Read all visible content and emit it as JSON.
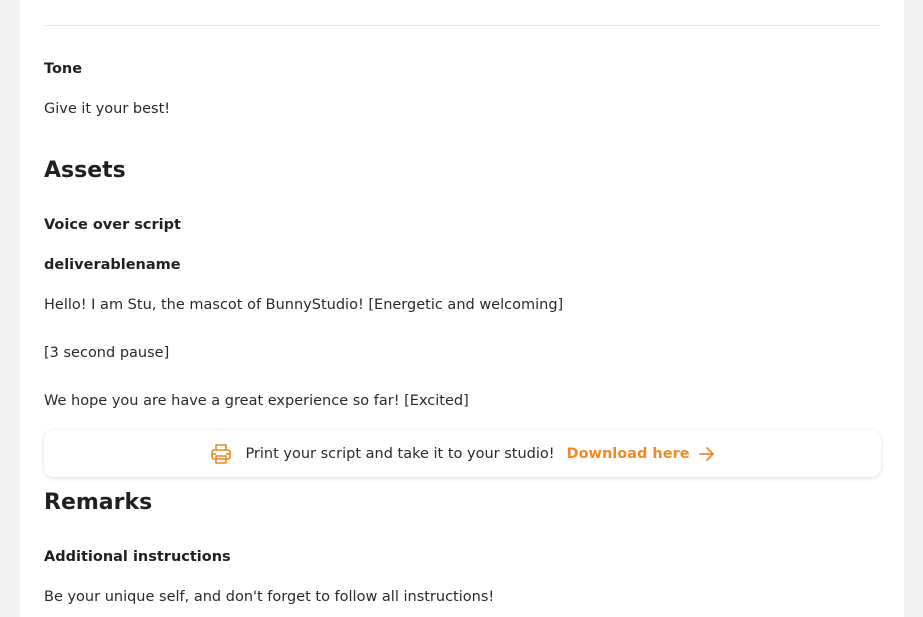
{
  "tone": {
    "label": "Tone",
    "value": "Give it your best!"
  },
  "assets": {
    "heading": "Assets",
    "voice_over_label": "Voice over script",
    "deliverable_label": "deliverablename",
    "script_lines": [
      "Hello! I am Stu, the mascot of BunnyStudio! [Energetic and welcoming]",
      "[3 second pause]",
      "We hope you are have a great experience so far! [Excited]"
    ]
  },
  "banner": {
    "text": "Print your script and take it to your studio!",
    "link": "Download here",
    "icon": "printer-icon",
    "accent": "#f08a24"
  },
  "remarks": {
    "heading": "Remarks",
    "instructions_label": "Additional instructions",
    "instructions_value": "Be your unique self, and don't forget to follow all instructions!"
  }
}
